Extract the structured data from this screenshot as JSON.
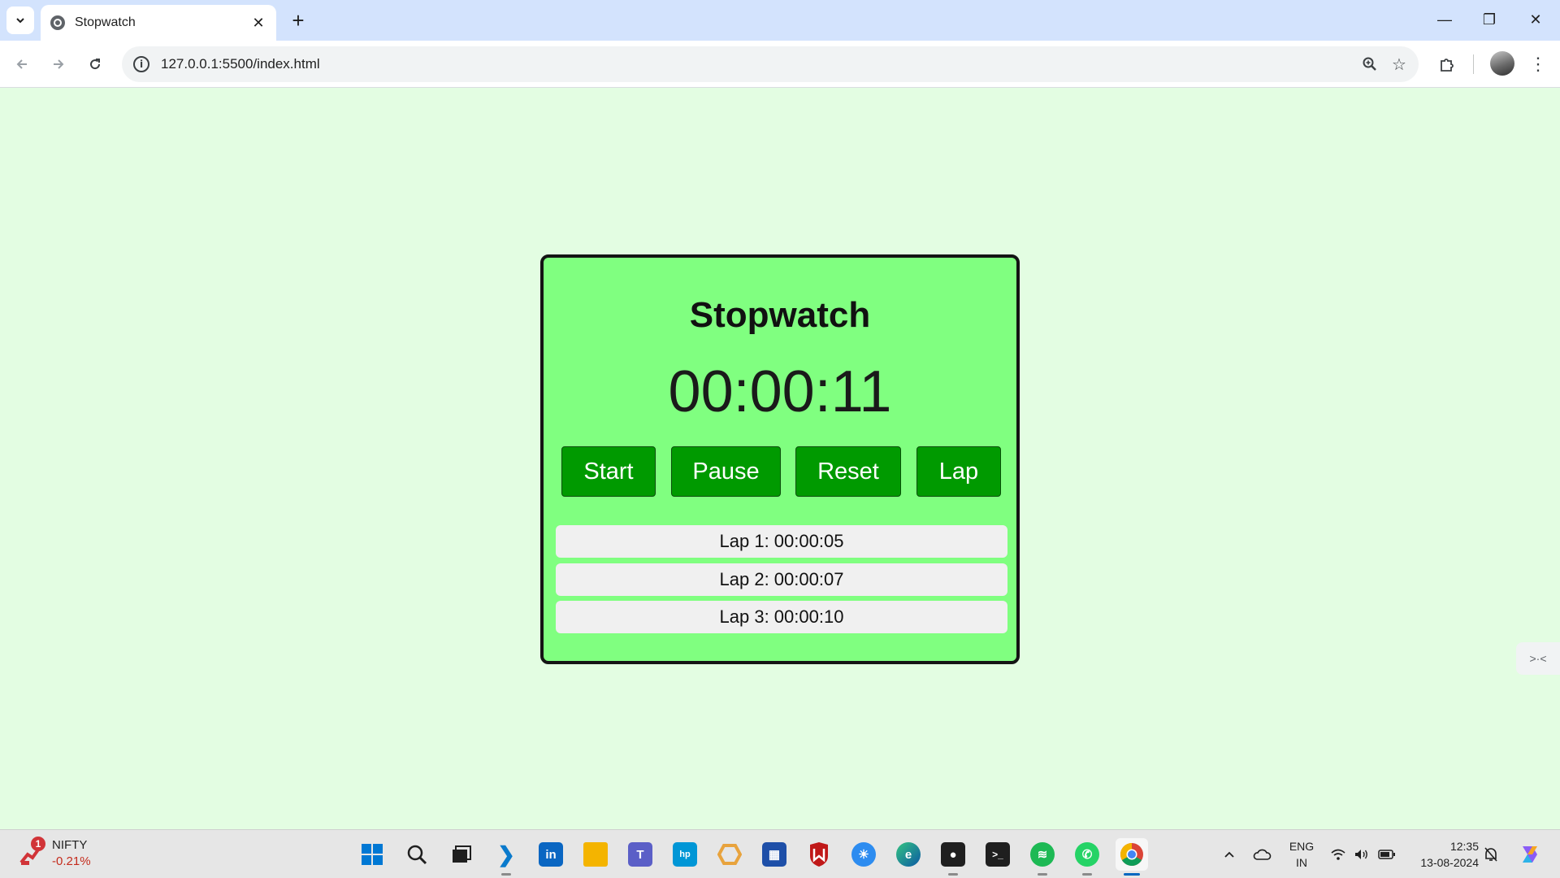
{
  "browser": {
    "tab_title": "Stopwatch",
    "tab_close": "✕",
    "new_tab": "+",
    "url": "127.0.0.1:5500/index.html",
    "window_controls": {
      "minimize": "—",
      "restore": "❐",
      "close": "✕"
    }
  },
  "stopwatch": {
    "title": "Stopwatch",
    "time": "00:00:11",
    "buttons": {
      "start": "Start",
      "pause": "Pause",
      "reset": "Reset",
      "lap": "Lap"
    },
    "laps": [
      "Lap 1: 00:00:05",
      "Lap 2: 00:00:07",
      "Lap 3: 00:00:10"
    ]
  },
  "taskbar": {
    "ticker_badge": "1",
    "ticker_name": "NIFTY",
    "ticker_change": "-0.21%",
    "language": [
      "ENG",
      "IN"
    ],
    "time": "12:35",
    "date": "13-08-2024"
  },
  "colors": {
    "page_background": "#e3fde2",
    "card_background": "#80ff80",
    "button_green": "#009a00",
    "lap_background": "#f0f0f0"
  }
}
